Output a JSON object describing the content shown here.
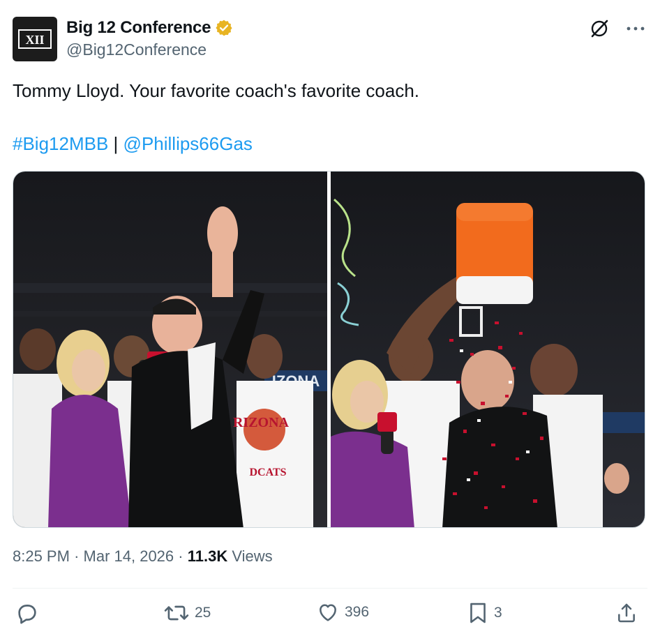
{
  "account": {
    "display_name": "Big 12 Conference",
    "handle": "@Big12Conference",
    "logo_text": "XII",
    "verified_color": "#e8b423"
  },
  "tweet": {
    "text": "Tommy Lloyd. Your favorite coach's favorite coach.",
    "hashtag": "#Big12MBB",
    "separator": "|",
    "mention": "@Phillips66Gas"
  },
  "media": {
    "photos": [
      {
        "icon": "photo-coach-waving"
      },
      {
        "icon": "photo-gatorade-shower"
      }
    ],
    "overlay_text_left": "IZONA",
    "overlay_text_jersey": "RIZONA",
    "overlay_text_jersey2": "DCATS"
  },
  "meta": {
    "time": "8:25 PM",
    "dot1": "·",
    "date": "Mar 14, 2026",
    "dot2": "·",
    "views_count": "11.3K",
    "views_label": "Views"
  },
  "actions": {
    "reply_count": "",
    "retweet_count": "25",
    "like_count": "396",
    "bookmark_count": "3"
  },
  "colors": {
    "link": "#1d9bf0",
    "muted": "#536471",
    "cooler_orange": "#f26b1d",
    "confetti": "#c8102e"
  }
}
